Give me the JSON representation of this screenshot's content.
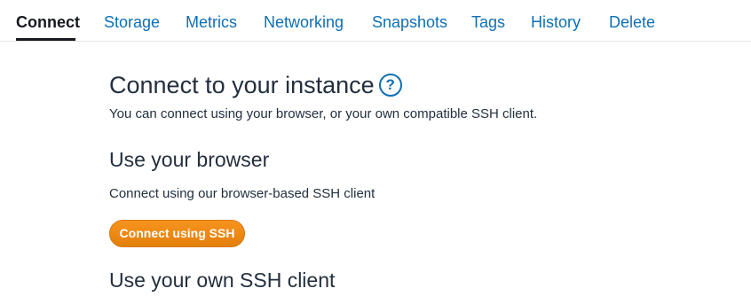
{
  "tabs": [
    {
      "label": "Connect",
      "active": true
    },
    {
      "label": "Storage",
      "active": false
    },
    {
      "label": "Metrics",
      "active": false
    },
    {
      "label": "Networking",
      "active": false
    },
    {
      "label": "Snapshots",
      "active": false
    },
    {
      "label": "Tags",
      "active": false
    },
    {
      "label": "History",
      "active": false
    },
    {
      "label": "Delete",
      "active": false
    }
  ],
  "main": {
    "title": "Connect to your instance",
    "help_icon": "help-question-icon",
    "help_glyph": "?",
    "subtitle": "You can connect using your browser, or your own compatible SSH client.",
    "browser_section": {
      "heading": "Use your browser",
      "description": "Connect using our browser-based SSH client",
      "button_label": "Connect using SSH"
    },
    "own_client_section": {
      "heading": "Use your own SSH client"
    }
  },
  "colors": {
    "link_blue": "#0f6fb4",
    "button_orange": "#f08c14",
    "text_dark": "#232f3e"
  }
}
